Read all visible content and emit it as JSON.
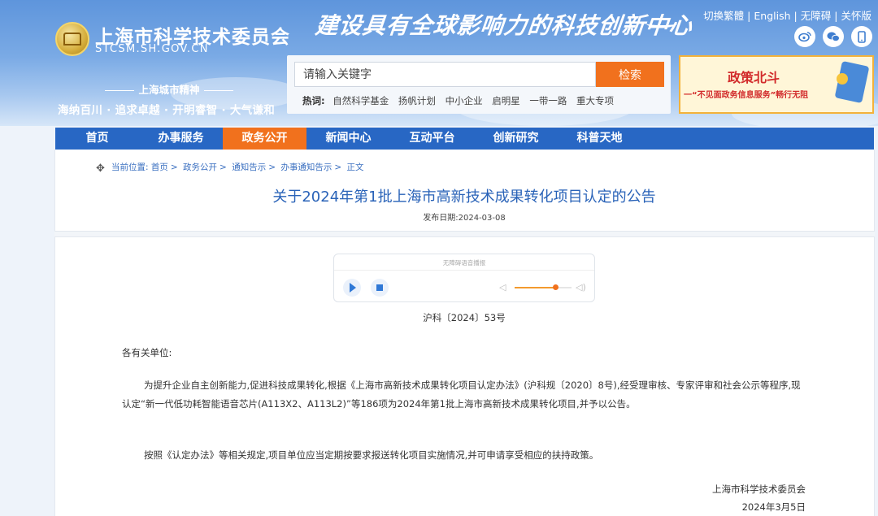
{
  "header": {
    "org_name_cn": "上海市科学技术委员会",
    "org_name_en": "STCSM.SH.GOV.CN",
    "slogan": "建设具有全球影响力的科技创新中心",
    "spirit_title": "上海城市精神",
    "spirit_text": "海纳百川 · 追求卓越 · 开明睿智 · 大气谦和",
    "top_links": [
      "切换繁體",
      "English",
      "无障碍",
      "关怀版"
    ],
    "social_icons": [
      "weibo-icon",
      "wechat-icon",
      "mobile-icon"
    ]
  },
  "search": {
    "placeholder": "请输入关键字",
    "button_label": "检索",
    "hot_label": "热词:",
    "hot_words": [
      "自然科学基金",
      "扬帆计划",
      "中小企业",
      "启明星",
      "一带一路",
      "重大专项"
    ]
  },
  "banner": {
    "title": "政策北斗",
    "subtitle": "一“不见面政务信息服务”畅行无阻"
  },
  "nav": {
    "items": [
      "首页",
      "办事服务",
      "政务公开",
      "新闻中心",
      "互动平台",
      "创新研究",
      "科普天地"
    ],
    "active_index": 2
  },
  "breadcrumb": {
    "label": "当前位置:",
    "items": [
      "首页",
      "政务公开",
      "通知告示",
      "办事通知告示",
      "正文"
    ]
  },
  "article": {
    "title": "关于2024年第1批上海市高新技术成果转化项目认定的公告",
    "pub_date": "发布日期:2024-03-08",
    "doc_no": "沪科〔2024〕53号",
    "salutation": "各有关单位:",
    "paragraph1": "为提升企业自主创新能力,促进科技成果转化,根据《上海市高新技术成果转化项目认定办法》(沪科规〔2020〕8号),经受理审核、专家评审和社会公示等程序,现认定“新一代低功耗智能语音芯片(A113X2、A113L2)”等186项为2024年第1批上海市高新技术成果转化项目,并予以公告。",
    "paragraph2": "按照《认定办法》等相关规定,项目单位应当定期按要求报送转化项目实施情况,并可申请享受相应的扶持政策。",
    "signature_org": "上海市科学技术委员会",
    "signature_date": "2024年3月5日"
  },
  "player": {
    "label": "无障碍语音播报",
    "volume": 0.72
  }
}
